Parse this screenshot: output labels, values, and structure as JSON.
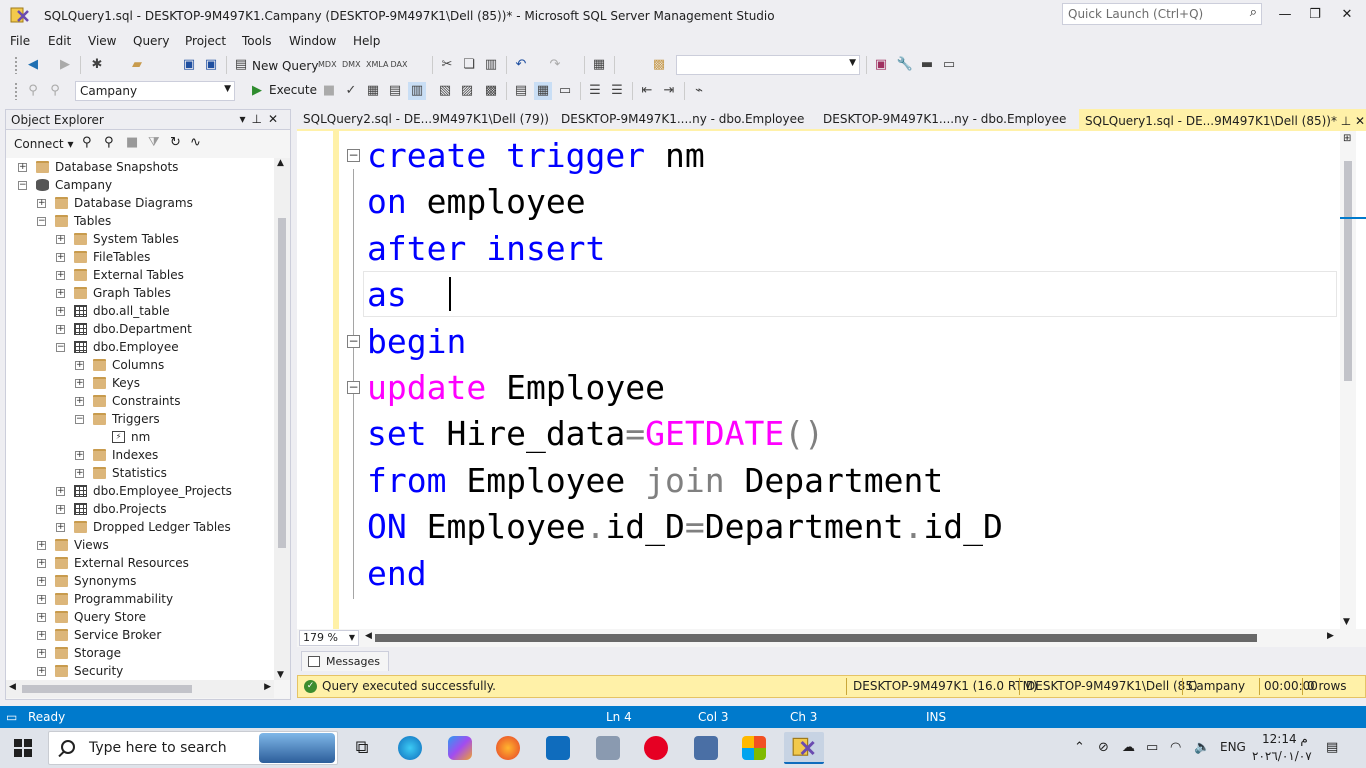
{
  "window": {
    "title": "SQLQuery1.sql - DESKTOP-9M497K1.Campany (DESKTOP-9M497K1\\Dell (85))* - Microsoft SQL Server Management Studio",
    "quick_launch_placeholder": "Quick Launch (Ctrl+Q)"
  },
  "menu": [
    "File",
    "Edit",
    "View",
    "Query",
    "Project",
    "Tools",
    "Window",
    "Help"
  ],
  "toolbar": {
    "new_query_label": "New Query",
    "execute_label": "Execute",
    "database_selected": "Campany",
    "solution_configuration": ""
  },
  "object_explorer": {
    "title": "Object Explorer",
    "connect_label": "Connect",
    "tree": [
      {
        "label": "Database Snapshots",
        "icon": "folder",
        "level": 1,
        "expander": "+"
      },
      {
        "label": "Campany",
        "icon": "database",
        "level": 1,
        "expander": "-"
      },
      {
        "label": "Database Diagrams",
        "icon": "folder",
        "level": 2,
        "expander": "+"
      },
      {
        "label": "Tables",
        "icon": "folder",
        "level": 2,
        "expander": "-"
      },
      {
        "label": "System Tables",
        "icon": "folder",
        "level": 3,
        "expander": "+"
      },
      {
        "label": "FileTables",
        "icon": "folder",
        "level": 3,
        "expander": "+"
      },
      {
        "label": "External Tables",
        "icon": "folder",
        "level": 3,
        "expander": "+"
      },
      {
        "label": "Graph Tables",
        "icon": "folder",
        "level": 3,
        "expander": "+"
      },
      {
        "label": "dbo.all_table",
        "icon": "table",
        "level": 3,
        "expander": "+"
      },
      {
        "label": "dbo.Department",
        "icon": "table",
        "level": 3,
        "expander": "+"
      },
      {
        "label": "dbo.Employee",
        "icon": "table",
        "level": 3,
        "expander": "-"
      },
      {
        "label": "Columns",
        "icon": "folder",
        "level": 4,
        "expander": "+"
      },
      {
        "label": "Keys",
        "icon": "folder",
        "level": 4,
        "expander": "+"
      },
      {
        "label": "Constraints",
        "icon": "folder",
        "level": 4,
        "expander": "+"
      },
      {
        "label": "Triggers",
        "icon": "folder",
        "level": 4,
        "expander": "-"
      },
      {
        "label": "nm",
        "icon": "trigger",
        "level": 5,
        "expander": ""
      },
      {
        "label": "Indexes",
        "icon": "folder",
        "level": 4,
        "expander": "+"
      },
      {
        "label": "Statistics",
        "icon": "folder",
        "level": 4,
        "expander": "+"
      },
      {
        "label": "dbo.Employee_Projects",
        "icon": "table",
        "level": 3,
        "expander": "+"
      },
      {
        "label": "dbo.Projects",
        "icon": "table",
        "level": 3,
        "expander": "+"
      },
      {
        "label": "Dropped Ledger Tables",
        "icon": "folder",
        "level": 3,
        "expander": "+"
      },
      {
        "label": "Views",
        "icon": "folder",
        "level": 2,
        "expander": "+"
      },
      {
        "label": "External Resources",
        "icon": "folder",
        "level": 2,
        "expander": "+"
      },
      {
        "label": "Synonyms",
        "icon": "folder",
        "level": 2,
        "expander": "+"
      },
      {
        "label": "Programmability",
        "icon": "folder",
        "level": 2,
        "expander": "+"
      },
      {
        "label": "Query Store",
        "icon": "folder",
        "level": 2,
        "expander": "+"
      },
      {
        "label": "Service Broker",
        "icon": "folder",
        "level": 2,
        "expander": "+"
      },
      {
        "label": "Storage",
        "icon": "folder",
        "level": 2,
        "expander": "+"
      },
      {
        "label": "Security",
        "icon": "folder",
        "level": 2,
        "expander": "+"
      }
    ]
  },
  "doc_tabs": [
    {
      "label": "SQLQuery2.sql - DE...9M497K1\\Dell (79))",
      "active": false
    },
    {
      "label": "DESKTOP-9M497K1....ny - dbo.Employee",
      "active": false
    },
    {
      "label": "DESKTOP-9M497K1....ny - dbo.Employee",
      "active": false
    },
    {
      "label": "SQLQuery1.sql - DE...9M497K1\\Dell (85))*",
      "active": true
    }
  ],
  "editor": {
    "lines": [
      [
        {
          "t": "create trigger",
          "c": "kw"
        },
        {
          "t": " nm",
          "c": ""
        }
      ],
      [
        {
          "t": "on",
          "c": "kw"
        },
        {
          "t": " employee",
          "c": ""
        }
      ],
      [
        {
          "t": "after insert",
          "c": "kw"
        }
      ],
      [
        {
          "t": "as",
          "c": "kw"
        }
      ],
      [
        {
          "t": "begin",
          "c": "kw"
        }
      ],
      [
        {
          "t": "update",
          "c": "fn"
        },
        {
          "t": " Employee",
          "c": ""
        }
      ],
      [
        {
          "t": "set",
          "c": "kw"
        },
        {
          "t": " Hire_data",
          "c": ""
        },
        {
          "t": "=",
          "c": "gray"
        },
        {
          "t": "GETDATE",
          "c": "fn"
        },
        {
          "t": "()",
          "c": "gray"
        }
      ],
      [
        {
          "t": "from",
          "c": "kw"
        },
        {
          "t": " Employee ",
          "c": ""
        },
        {
          "t": "join",
          "c": "gray"
        },
        {
          "t": " Department",
          "c": ""
        }
      ],
      [
        {
          "t": "ON",
          "c": "kw"
        },
        {
          "t": " Employee",
          "c": ""
        },
        {
          "t": ".",
          "c": "gray"
        },
        {
          "t": "id_D",
          "c": ""
        },
        {
          "t": "=",
          "c": "gray"
        },
        {
          "t": "Department",
          "c": ""
        },
        {
          "t": ".",
          "c": "gray"
        },
        {
          "t": "id_D",
          "c": ""
        }
      ],
      [
        {
          "t": "end",
          "c": "kw"
        }
      ]
    ],
    "zoom": "179 %"
  },
  "results": {
    "messages_tab": "Messages"
  },
  "query_status": {
    "message": "Query executed successfully.",
    "server": "DESKTOP-9M497K1 (16.0 RTM)",
    "user": "DESKTOP-9M497K1\\Dell (85)",
    "database": "Campany",
    "elapsed": "00:00:00",
    "rows": "0 rows"
  },
  "statusbar": {
    "ready": "Ready",
    "ln": "Ln 4",
    "col": "Col 3",
    "ch": "Ch 3",
    "ins": "INS"
  },
  "taskbar": {
    "search_placeholder": "Type here to search",
    "language": "ENG",
    "time": "12:14 م",
    "date": "٢٠٢٦/٠١/٠٧"
  },
  "colors": {
    "accent": "#007acc",
    "keyword": "#0000ff",
    "function": "#ff00ff",
    "operator": "#808080",
    "status_yellow": "#fff1a8"
  }
}
